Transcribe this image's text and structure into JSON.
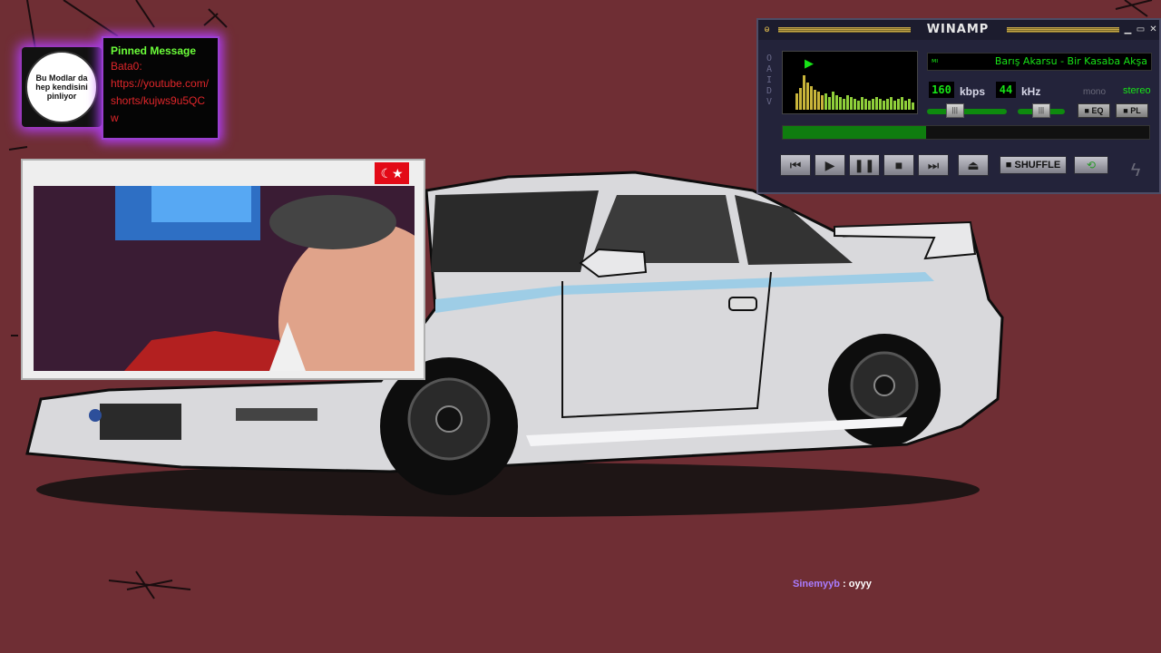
{
  "pinned": {
    "avatar_text": "Bu Modlar da hep kendisini pinliyor",
    "title": "Pinned Message",
    "user": "Bata0:",
    "text": "https://youtube.com/shorts/kujws9u5QCw"
  },
  "video": {
    "flag_icon": "turkey-flag-icon"
  },
  "winamp": {
    "title": "WINAMP",
    "oaidv": [
      "O",
      "A",
      "I",
      "D",
      "V"
    ],
    "track_prefix": "мı",
    "track": "Barış Akarsu - Bir Kasaba Akşa",
    "bitrate": "160",
    "bitrate_unit": "kbps",
    "samplerate": "44",
    "samplerate_unit": "kHz",
    "mono_label": "mono",
    "stereo_label": "stereo",
    "eq_label": "EQ",
    "pl_label": "PL",
    "shuffle_label": "SHUFFLE",
    "seek_progress": 0.39,
    "volume_level": 0.35,
    "balance_level": 0.5,
    "controls": [
      "previous",
      "play",
      "pause",
      "stop",
      "next",
      "eject"
    ]
  },
  "chat": {
    "user": "Sinemyyb",
    "separator": " : ",
    "text": "oyyy"
  },
  "colors": {
    "background": "#6f2e34",
    "pin_glow": "#b23fff",
    "lcd_green": "#17e317",
    "pin_title": "#6cff3a",
    "pin_text": "#e0262a"
  }
}
